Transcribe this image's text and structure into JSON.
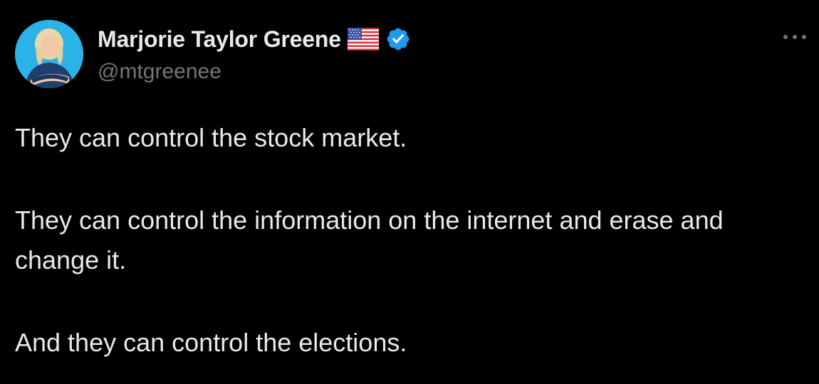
{
  "tweet": {
    "author": {
      "display_name": "Marjorie Taylor Greene",
      "handle": "@mtgreenee",
      "badge_flag_icon": "us-flag-icon",
      "verified_icon": "verified-badge-icon",
      "verified_color": "#1d9bf0"
    },
    "more_icon": "more-options-icon",
    "paragraphs": [
      "They can control the stock market.",
      "They can control the information on the internet and erase and change it.",
      "And they can control the elections."
    ]
  },
  "colors": {
    "background": "#000000",
    "primary_text": "#e7e9ea",
    "secondary_text": "#71767b",
    "accent": "#1d9bf0"
  }
}
